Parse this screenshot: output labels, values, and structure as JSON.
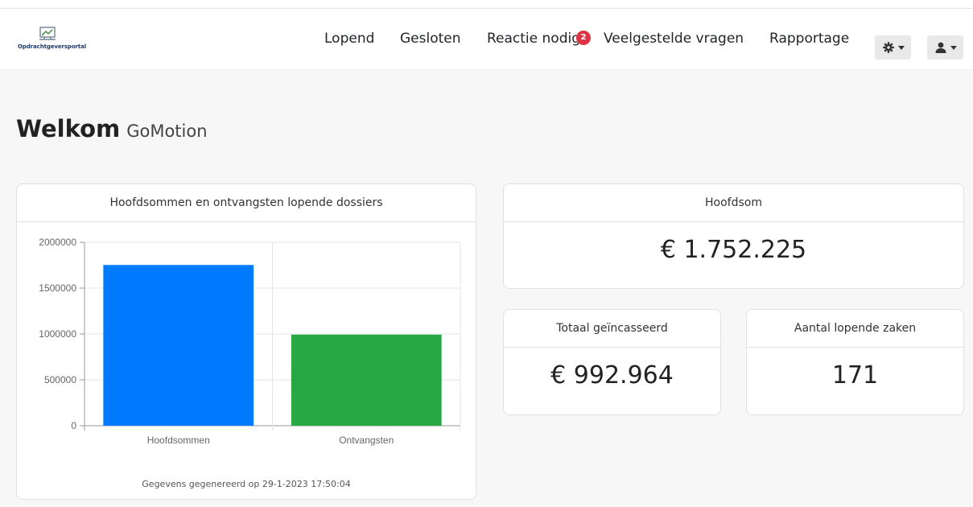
{
  "nav": {
    "brand": "Opdrachtgeversportal",
    "links": [
      "Lopend",
      "Gesloten",
      "Reactie nodig",
      "Veelgestelde vragen",
      "Rapportage"
    ],
    "badge": "2",
    "settings_icon": "gear-icon",
    "user_icon": "user-icon"
  },
  "welcome": {
    "title": "Welkom",
    "name": "GoMotion"
  },
  "chart_card": {
    "title": "Hoofdsommen en ontvangsten lopende dossiers",
    "footnote": "Gegevens gegenereerd op 29-1-2023 17:50:04"
  },
  "chart_data": {
    "type": "bar",
    "categories": [
      "Hoofdsommen",
      "Ontvangsten"
    ],
    "values": [
      1752225,
      992964
    ],
    "colors": [
      "#007bff",
      "#28a745"
    ],
    "ylim": [
      0,
      2000000
    ],
    "yticks": [
      "2000000",
      "1500000",
      "1000000",
      "500000",
      "0"
    ],
    "grid": true
  },
  "stats": {
    "hoofdsom": {
      "label": "Hoofdsom",
      "value": "€ 1.752.225"
    },
    "geincasseerd": {
      "label": "Totaal geïncasseerd",
      "value": "€ 992.964"
    },
    "zaken": {
      "label": "Aantal lopende zaken",
      "value": "171"
    }
  }
}
